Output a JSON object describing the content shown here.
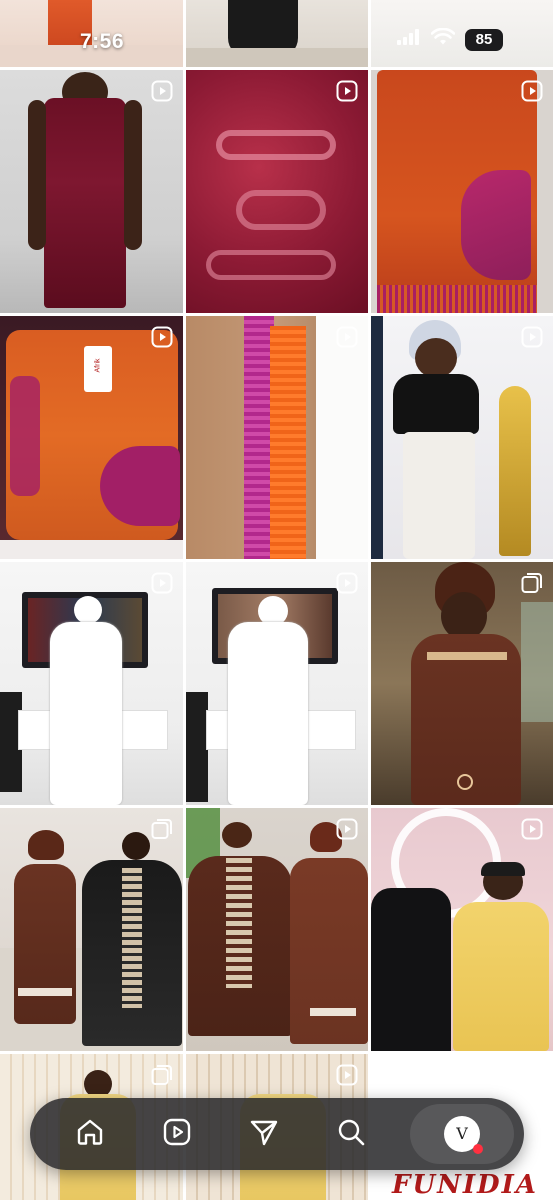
{
  "status_bar": {
    "time": "7:56",
    "battery": "85",
    "icons": [
      "signal-icon",
      "wifi-icon"
    ]
  },
  "posts": [
    {
      "type": "none"
    },
    {
      "type": "none"
    },
    {
      "type": "none"
    },
    {
      "type": "reel"
    },
    {
      "type": "reel"
    },
    {
      "type": "reel"
    },
    {
      "type": "reel"
    },
    {
      "type": "reel"
    },
    {
      "type": "reel"
    },
    {
      "type": "reel"
    },
    {
      "type": "reel"
    },
    {
      "type": "carousel"
    },
    {
      "type": "carousel"
    },
    {
      "type": "reel"
    },
    {
      "type": "reel"
    },
    {
      "type": "carousel"
    },
    {
      "type": "reel"
    },
    {
      "type": "none"
    }
  ],
  "tile_labels": {
    "bag_tag": "Afrik",
    "brand_bottom": "FUNIDIA"
  },
  "bottom_nav": {
    "items": [
      "home-icon",
      "reels-icon",
      "messages-icon",
      "search-icon",
      "profile"
    ],
    "avatar_logo": "V",
    "notification_color": "#ff3040"
  },
  "colors": {
    "nav_background": "#28282a",
    "reel_badge": "#ffffff"
  }
}
